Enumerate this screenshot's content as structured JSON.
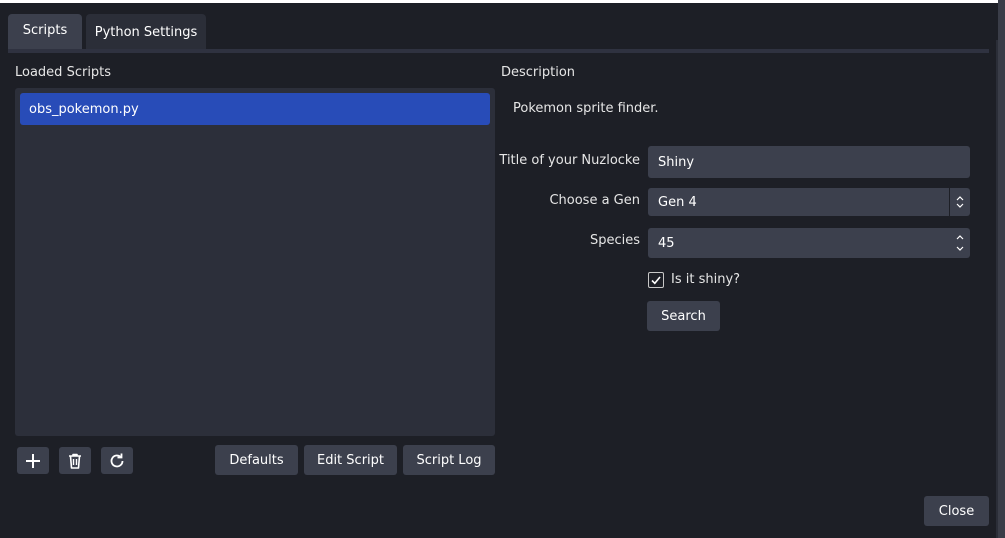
{
  "tabs": [
    {
      "label": "Scripts",
      "active": true
    },
    {
      "label": "Python Settings",
      "active": false
    }
  ],
  "loaded_scripts": {
    "heading": "Loaded Scripts",
    "items": [
      "obs_pokemon.py"
    ],
    "selected_index": 0
  },
  "toolbar": {
    "add_icon": "plus-icon",
    "remove_icon": "trash-icon",
    "reload_icon": "refresh-icon",
    "defaults_label": "Defaults",
    "edit_label": "Edit Script",
    "log_label": "Script Log"
  },
  "description": {
    "heading": "Description",
    "text": "Pokemon sprite finder."
  },
  "settings": {
    "title_label": "Title of your Nuzlocke",
    "title_value": "Shiny",
    "gen_label": "Choose a Gen",
    "gen_value": "Gen 4",
    "species_label": "Species",
    "species_value": "45",
    "shiny_label": "Is it shiny?",
    "shiny_checked": true,
    "search_label": "Search"
  },
  "close_label": "Close",
  "colors": {
    "background": "#1d1f26",
    "panel": "#2c2f3a",
    "control": "#3c404d",
    "selection": "#284cb8"
  }
}
